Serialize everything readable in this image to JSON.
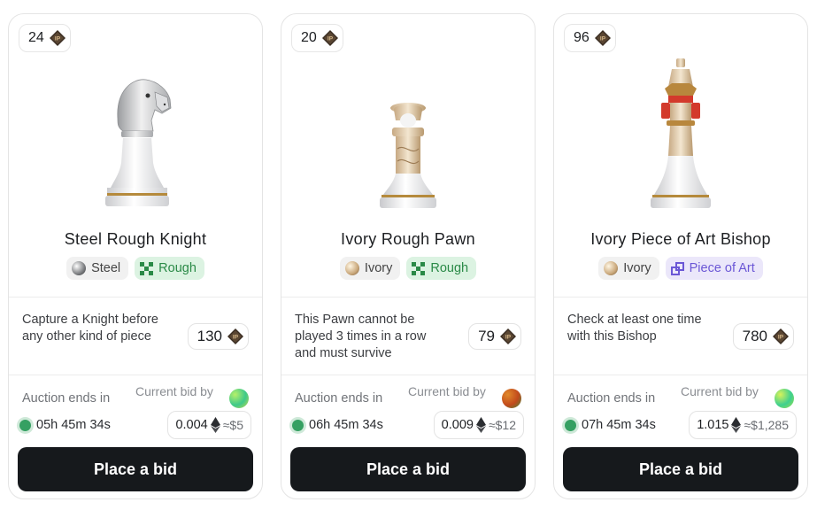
{
  "cards": [
    {
      "rank": "24",
      "name": "Steel Rough Knight",
      "material": "Steel",
      "quality": "Rough",
      "quest": "Capture a Knight before any other kind of piece",
      "reward": "130",
      "auction_label": "Auction ends in",
      "bid_label": "Current bid by",
      "timer": "05h 45m 34s",
      "bid": "0.004",
      "usd": "≈$5",
      "button": "Place a bid"
    },
    {
      "rank": "20",
      "name": "Ivory Rough Pawn",
      "material": "Ivory",
      "quality": "Rough",
      "quest": "This Pawn cannot be played 3 times in a row and must survive",
      "reward": "79",
      "auction_label": "Auction ends in",
      "bid_label": "Current bid by",
      "timer": "06h 45m 34s",
      "bid": "0.009",
      "usd": "≈$12",
      "button": "Place a bid"
    },
    {
      "rank": "96",
      "name": "Ivory Piece of Art Bishop",
      "material": "Ivory",
      "quality": "Piece of Art",
      "quest": "Check at least one time with this Bishop",
      "reward": "780",
      "auction_label": "Auction ends in",
      "bid_label": "Current bid by",
      "timer": "07h 45m 34s",
      "bid": "1.015",
      "usd": "≈$1,285",
      "button": "Place a bid"
    }
  ],
  "icons": {
    "token": "ip-token-icon",
    "currency": "ethereum-icon",
    "live": "live-dot-icon",
    "rough": "checker-icon",
    "art": "puzzle-icon"
  },
  "colors": {
    "button_bg": "#16191c",
    "rough_bg": "#dcf3e2",
    "rough_text": "#2a8a47",
    "art_bg": "#ebe7fa",
    "art_text": "#6b57d6",
    "live": "#35a062"
  }
}
